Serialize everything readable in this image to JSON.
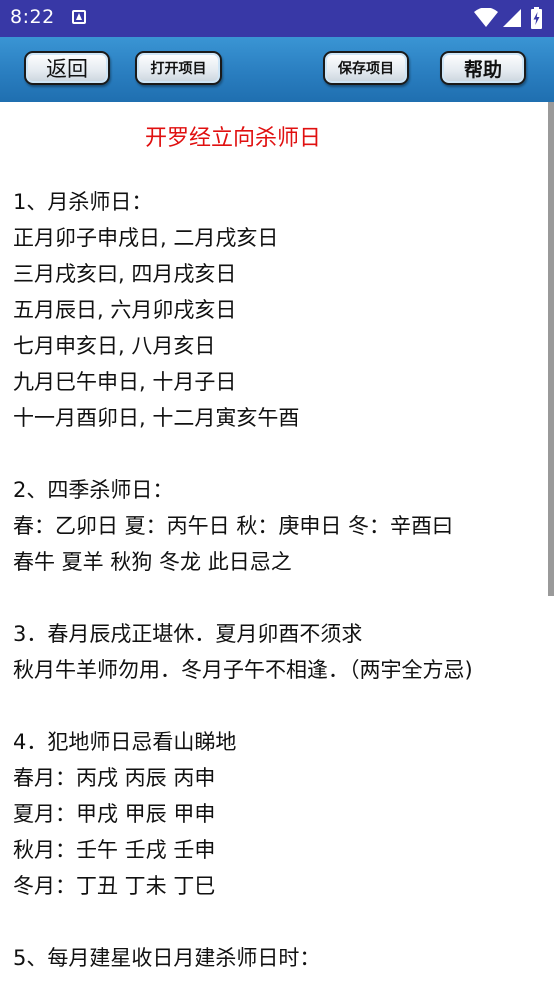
{
  "status": {
    "time": "8:22"
  },
  "toolbar": {
    "back_label": "返回",
    "open_label": "打开项目",
    "save_label": "保存项目",
    "help_label": "帮助"
  },
  "doc": {
    "title": "开罗经立向杀师日",
    "sections": [
      {
        "lines": [
          "1、月杀师日：",
          "正月卯子申戌日, 二月戌亥日",
          "三月戌亥曰, 四月戌亥日",
          "五月辰日, 六月卯戌亥日",
          "七月申亥日, 八月亥日",
          "九月巳午申日, 十月子日",
          "十一月酉卯日, 十二月寅亥午酉"
        ]
      },
      {
        "lines": [
          "2、四季杀师日：",
          "春：乙卯日 夏：丙午日 秋：庚申日 冬：辛酉曰",
          "春牛 夏羊 秋狗 冬龙 此日忌之"
        ]
      },
      {
        "lines": [
          "3．春月辰戌正堪休．夏月卯酉不须求",
          "秋月牛羊师勿用．冬月子午不相逢．（两宇全方忌)"
        ]
      },
      {
        "lines": [
          "4．犯地师日忌看山睇地",
          "春月：丙戌 丙辰 丙申",
          "夏月：甲戌 甲辰 甲申",
          "秋月：壬午 壬戌 壬申",
          "冬月：丁丑 丁未 丁巳"
        ]
      },
      {
        "lines": [
          "5、每月建星收日月建杀师日时："
        ]
      }
    ]
  }
}
